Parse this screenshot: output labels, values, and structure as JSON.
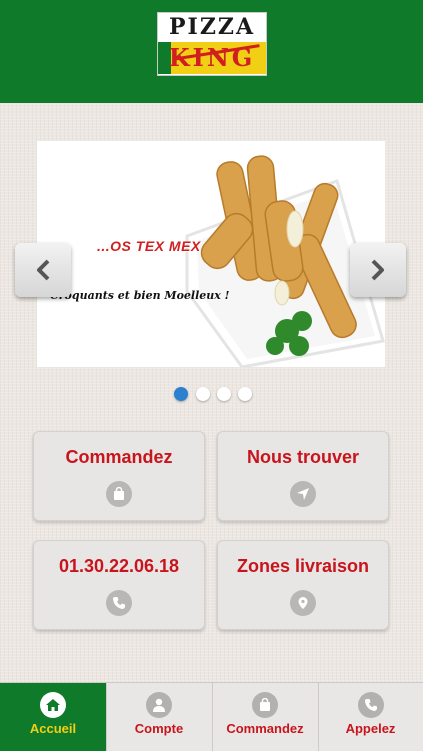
{
  "header": {
    "logo_top": "PIZZA",
    "logo_bottom": "KING"
  },
  "carousel": {
    "title": "...OS TEX MEX",
    "subtitle": "Croquants et bien Moelleux !",
    "slide_count": 4,
    "active_index": 0
  },
  "tiles": [
    {
      "label": "Commandez",
      "icon": "shopping-bag-icon"
    },
    {
      "label": "Nous trouver",
      "icon": "location-arrow-icon"
    },
    {
      "label": "01.30.22.06.18",
      "icon": "phone-icon"
    },
    {
      "label": "Zones livraison",
      "icon": "map-pin-icon"
    }
  ],
  "tabbar": [
    {
      "label": "Accueil",
      "icon": "home-icon",
      "active": true
    },
    {
      "label": "Compte",
      "icon": "user-icon",
      "active": false
    },
    {
      "label": "Commandez",
      "icon": "shopping-bag-icon",
      "active": false
    },
    {
      "label": "Appelez",
      "icon": "phone-icon",
      "active": false
    }
  ],
  "colors": {
    "brand_green": "#0f7a2a",
    "accent_red": "#c8141c",
    "accent_yellow": "#f1cf14",
    "dot_active": "#2d7fd0"
  }
}
